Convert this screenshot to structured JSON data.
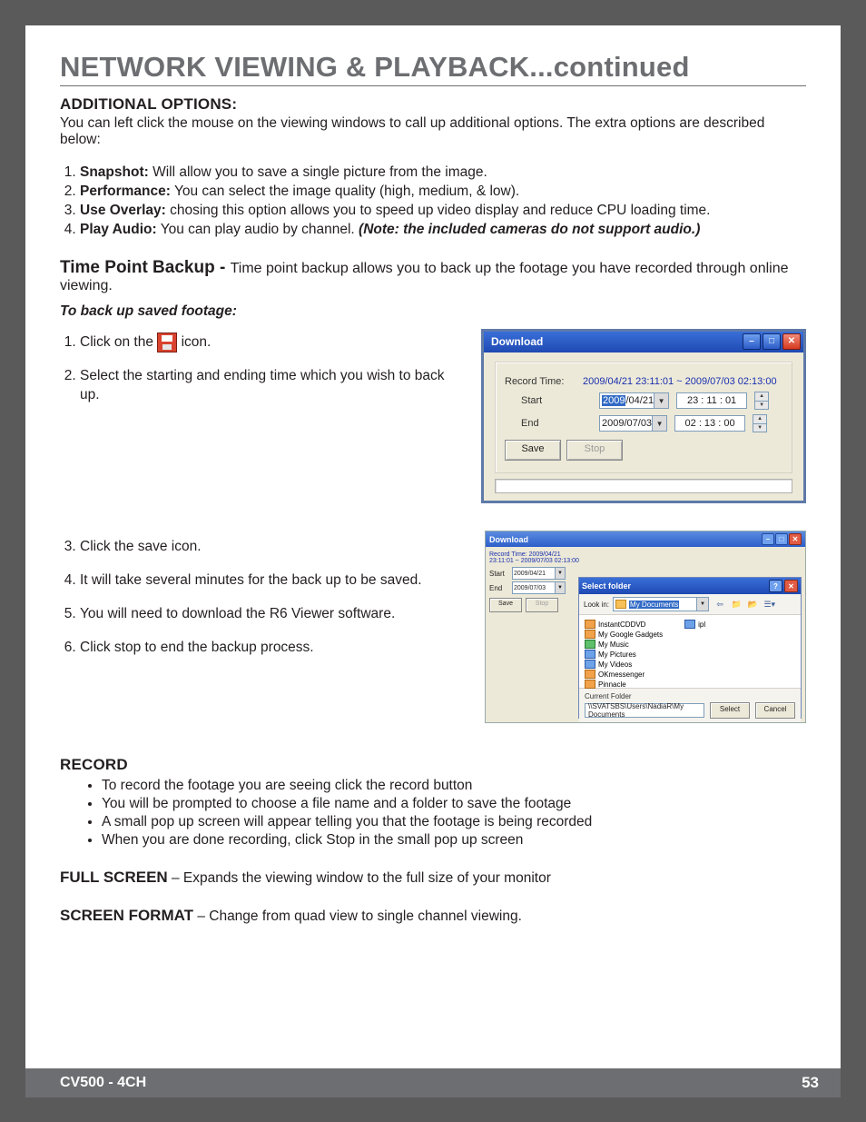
{
  "page": {
    "title": "NETWORK VIEWING & PLAYBACK...continued",
    "footer_left": "CV500 - 4CH",
    "footer_right": "53"
  },
  "additional": {
    "heading": "ADDITIONAL OPTIONS:",
    "intro": "You can left click the mouse on the viewing windows to call up additional options. The extra options are described below:",
    "items": [
      {
        "label": "Snapshot:",
        "text": " Will allow you to save a single picture from the image."
      },
      {
        "label": "Performance:",
        "text": " You can select the image quality (high, medium, & low)."
      },
      {
        "label": "Use Overlay:",
        "text": " chosing this option allows you to speed up video display and reduce CPU loading time."
      },
      {
        "label": "Play Audio:",
        "text": " You can play audio by channel. ",
        "note": "(Note: the included cameras do not support audio.)"
      }
    ]
  },
  "timepoint": {
    "label": "Time Point Backup - ",
    "desc": " Time point backup allows you to back up the footage you have recorded through online viewing.",
    "sub": "To back up saved footage:",
    "steps_a": [
      "Click on the ",
      "Select the starting and ending time which you wish to back up."
    ],
    "after_icon": " icon.",
    "steps_b": [
      "Click the save icon.",
      "It will take several minutes for the back up to be saved.",
      "You will need to download the R6 Viewer software.",
      "Click stop to end the backup process."
    ]
  },
  "downloadWin": {
    "title": "Download",
    "record_label": "Record Time:",
    "record_value": "2009/04/21 23:11:01 ~ 2009/07/03 02:13:00",
    "start_label": "Start",
    "start_date_prefix": "2009",
    "start_date_suffix": "/04/21",
    "start_time": "23 : 11 : 01",
    "end_label": "End",
    "end_date": "2009/07/03",
    "end_time": "02 : 13 : 00",
    "save": "Save",
    "stop": "Stop"
  },
  "shotB": {
    "title": "Download",
    "rt_label": "Record Time:",
    "rt_value": "2009/04/21 23:11:01 ~ 2009/07/03 02:13:00",
    "start": "Start",
    "start_date": "2009/04/21",
    "end": "End",
    "end_date": "2009/07/03",
    "save": "Save",
    "stop": "Stop",
    "sel_title": "Select folder",
    "lookin_label": "Look in:",
    "lookin_value": "My Documents",
    "files": [
      "InstantCDDVD",
      "My Google Gadgets",
      "My Music",
      "My Pictures",
      "My Videos",
      "OKmessenger",
      "Pinnacle"
    ],
    "extra": "ipl",
    "current_label": "Current Folder",
    "path": "\\\\SVATSBS\\Users\\NadiaR\\My Documents",
    "select": "Select",
    "cancel": "Cancel"
  },
  "record": {
    "heading": "RECORD",
    "bullets": [
      "To record the footage you are seeing click the record button",
      "You will be prompted to choose a file name and a folder to save the footage",
      "A small pop up screen will appear telling you that the footage is being recorded",
      "When you are done recording, click Stop in the small pop up screen"
    ]
  },
  "fullscreen": {
    "label": "FULL SCREEN",
    "text": " – Expands the viewing window to the full size of your monitor"
  },
  "screenformat": {
    "label": "SCREEN FORMAT",
    "text": " – Change from quad view to single channel viewing."
  }
}
